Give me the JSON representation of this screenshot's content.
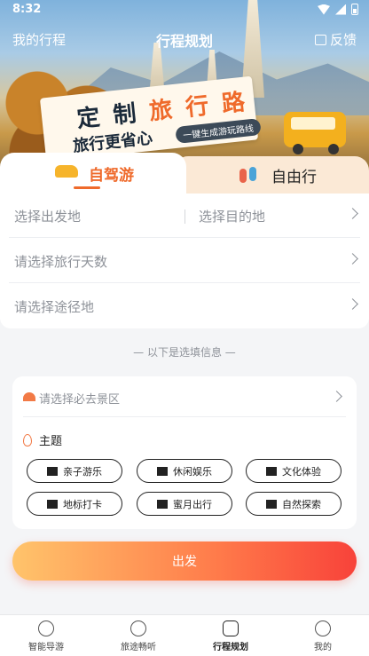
{
  "status": {
    "time": "8:32"
  },
  "header": {
    "left_link": "我的行程",
    "title": "行程规划",
    "right_link": "反馈"
  },
  "hero": {
    "slogan_prefix": "定 制",
    "slogan_highlight": "旅 行 路",
    "slogan_sub": "旅行更省心",
    "tagline": "一键生成游玩路线"
  },
  "tabs": [
    {
      "label": "自驾游",
      "active": true
    },
    {
      "label": "自由行",
      "active": false
    }
  ],
  "form": {
    "departure_placeholder": "选择出发地",
    "destination_placeholder": "选择目的地",
    "days_placeholder": "请选择旅行天数",
    "waypoints_placeholder": "请选择途径地"
  },
  "optional_divider": "— 以下是选填信息 —",
  "extras": {
    "sights_placeholder": "请选择必去景区",
    "theme_title": "主题",
    "themes": [
      "亲子游乐",
      "休闲娱乐",
      "文化体验",
      "地标打卡",
      "蜜月出行",
      "自然探索"
    ]
  },
  "submit_label": "出发",
  "tabbar": [
    {
      "label": "智能导游",
      "active": false
    },
    {
      "label": "旅途畅听",
      "active": false
    },
    {
      "label": "行程规划",
      "active": true
    },
    {
      "label": "我的",
      "active": false
    }
  ],
  "colors": {
    "accent": "#ef6a2b",
    "button_start": "#ffc46b",
    "button_end": "#f8423a"
  }
}
